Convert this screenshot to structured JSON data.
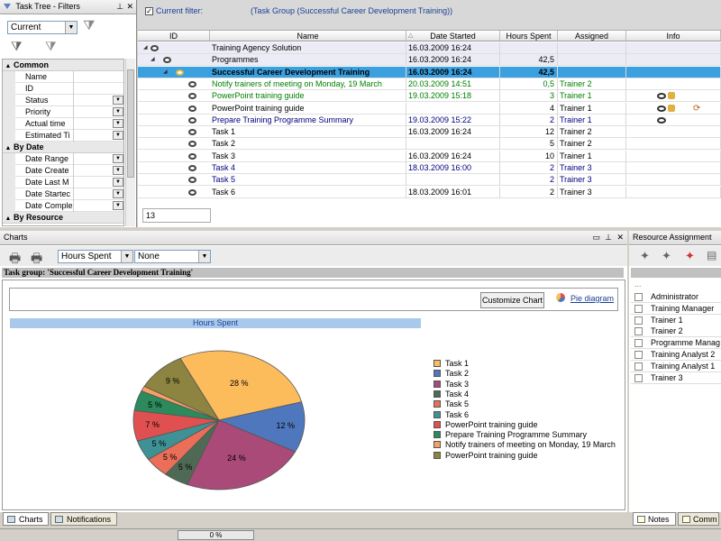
{
  "filters_panel": {
    "title": "Task Tree - Filters",
    "current_filter": "Current",
    "groups": [
      {
        "name": "Common",
        "items": [
          {
            "label": "Name",
            "dd": false
          },
          {
            "label": "ID",
            "dd": false
          },
          {
            "label": "Status",
            "dd": true
          },
          {
            "label": "Priority",
            "dd": true
          },
          {
            "label": "Actual time",
            "dd": true
          },
          {
            "label": "Estimated Ti",
            "dd": true
          }
        ]
      },
      {
        "name": "By Date",
        "items": [
          {
            "label": "Date Range",
            "dd": true
          },
          {
            "label": "Date Create",
            "dd": true
          },
          {
            "label": "Date Last M",
            "dd": true
          },
          {
            "label": "Date Startec",
            "dd": true
          },
          {
            "label": "Date Comple",
            "dd": true
          }
        ]
      },
      {
        "name": "By Resource",
        "items": []
      }
    ]
  },
  "task_grid": {
    "filter_label": "Current filter:",
    "filter_value": "(Task Group  (Successful Career Development Training))",
    "columns": [
      "ID",
      "Name",
      "Date Started",
      "Hours Spent",
      "Assigned",
      "Info"
    ],
    "rows": [
      {
        "name": "Training Agency Solution",
        "date": "16.03.2009 16:24",
        "hours": "",
        "assigned": "",
        "color": "#000000",
        "level": 0
      },
      {
        "name": "Programmes",
        "date": "16.03.2009 16:24",
        "hours": "42,5",
        "assigned": "",
        "color": "#000000",
        "level": 1
      },
      {
        "name": "Successful Career Development Training",
        "date": "16.03.2009 16:24",
        "hours": "42,5",
        "assigned": "",
        "color": "#000000",
        "level": 2,
        "selected": true
      },
      {
        "name": "Notify trainers of meeting on Monday, 19 March",
        "date": "20.03.2009 14:51",
        "hours": "0,5",
        "assigned": "Trainer 2",
        "color": "#008000",
        "level": 3
      },
      {
        "name": "PowerPoint training guide",
        "date": "19.03.2009 15:18",
        "hours": "3",
        "assigned": "Trainer 1",
        "color": "#008000",
        "level": 3
      },
      {
        "name": "PowerPoint training guide",
        "date": "",
        "hours": "4",
        "assigned": "Trainer 1",
        "color": "#000000",
        "level": 3
      },
      {
        "name": "Prepare Training Programme Summary",
        "date": "19.03.2009 15:22",
        "hours": "2",
        "assigned": "Trainer 1",
        "color": "#000080",
        "level": 3
      },
      {
        "name": "Task 1",
        "date": "16.03.2009 16:24",
        "hours": "12",
        "assigned": "Trainer 2",
        "color": "#000000",
        "level": 3
      },
      {
        "name": "Task 2",
        "date": "",
        "hours": "5",
        "assigned": "Trainer 2",
        "color": "#000000",
        "level": 3
      },
      {
        "name": "Task 3",
        "date": "16.03.2009 16:24",
        "hours": "10",
        "assigned": "Trainer 1",
        "color": "#000000",
        "level": 3
      },
      {
        "name": "Task 4",
        "date": "18.03.2009 16:00",
        "hours": "2",
        "assigned": "Trainer 3",
        "color": "#000080",
        "level": 3
      },
      {
        "name": "Task 5",
        "date": "",
        "hours": "2",
        "assigned": "Trainer 3",
        "color": "#000080",
        "level": 3
      },
      {
        "name": "Task 6",
        "date": "18.03.2009 16:01",
        "hours": "2",
        "assigned": "Trainer 3",
        "color": "#000000",
        "level": 3
      }
    ],
    "count": "13"
  },
  "charts_panel": {
    "title": "Charts",
    "metric_select": "Hours Spent",
    "group_select": "None",
    "task_group_label": "Task group: 'Successful Career Development Training'",
    "customize_button": "Customize Chart",
    "chart_type_link": "Pie diagram",
    "tabs": [
      "Charts",
      "Notifications"
    ]
  },
  "chart_data": {
    "type": "pie",
    "title": "Hours Spent",
    "slices": [
      {
        "label": "Task 1",
        "value": 12,
        "pct_label": "28 %",
        "color": "#fcbc5c"
      },
      {
        "label": "Task 2",
        "value": 5,
        "pct_label": "12 %",
        "color": "#4f77bd"
      },
      {
        "label": "Task 3",
        "value": 10,
        "pct_label": "24 %",
        "color": "#a94a78"
      },
      {
        "label": "Task 4",
        "value": 2,
        "pct_label": "5 %",
        "color": "#4f6a54"
      },
      {
        "label": "Task 5",
        "value": 2,
        "pct_label": "5 %",
        "color": "#ea6e58"
      },
      {
        "label": "Task 6",
        "value": 2,
        "pct_label": "5 %",
        "color": "#3e9296"
      },
      {
        "label": "PowerPoint training guide",
        "value": 3,
        "pct_label": "7 %",
        "color": "#e05050"
      },
      {
        "label": "Prepare Training Programme Summary",
        "value": 2,
        "pct_label": "5 %",
        "color": "#2c8a5c"
      },
      {
        "label": "Notify trainers of meeting on Monday, 19 March",
        "value": 0.5,
        "pct_label": "",
        "color": "#f8a060"
      },
      {
        "label": "PowerPoint training guide",
        "value": 4,
        "pct_label": "9 %",
        "color": "#8c8440"
      }
    ]
  },
  "resource_panel": {
    "title": "Resource Assignment",
    "resources": [
      "Administrator",
      "Training Manager",
      "Trainer 1",
      "Trainer 2",
      "Programme Manag",
      "Training Analyst 2",
      "Training Analyst 1",
      "Trainer 3"
    ],
    "tabs": [
      "Notes",
      "Comm"
    ]
  },
  "status_bar": {
    "progress": "0 %"
  }
}
